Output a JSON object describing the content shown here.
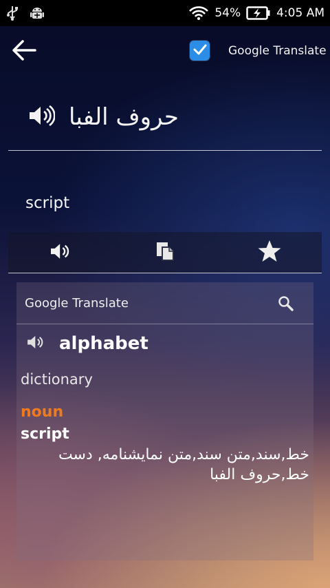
{
  "status_bar": {
    "battery": "54%",
    "time": "4:05 AM",
    "icons": [
      "usb-icon",
      "android-debug-icon",
      "wifi-icon",
      "battery-charging-icon"
    ]
  },
  "action_bar": {
    "back_icon": "arrow-left-icon",
    "auto_translate_checked": true,
    "source_label": "Google Translate"
  },
  "source": {
    "text": "حروف الفبا"
  },
  "translation": {
    "text": "script"
  },
  "toolbar": {
    "icons": [
      "speaker-icon",
      "copy-icon",
      "star-icon"
    ]
  },
  "card": {
    "title": "Google Translate",
    "word": "alphabet",
    "section_label": "dictionary",
    "part_of_speech": "noun",
    "term": "script",
    "definitions": "خط,سند,متن سند,متن نمایشنامه, دست خط,حروف الفبا"
  },
  "colors": {
    "accent_blue": "#2b8de6",
    "pos_orange": "#f07a1e"
  }
}
